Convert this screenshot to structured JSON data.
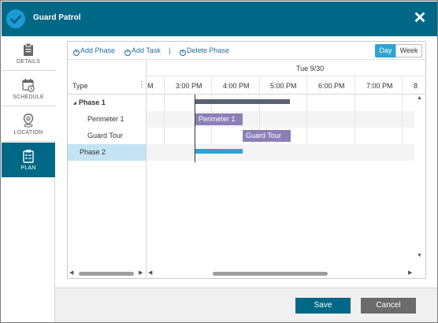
{
  "window": {
    "title": "Guard Patrol"
  },
  "sidebar": {
    "items": [
      {
        "label": "DETAILS",
        "icon": "clipboard-icon",
        "active": false
      },
      {
        "label": "SCHEDULE",
        "icon": "calendar-clock-icon",
        "active": false
      },
      {
        "label": "LOCATION",
        "icon": "map-pin-icon",
        "active": false
      },
      {
        "label": "PLAN",
        "icon": "plan-checklist-icon",
        "active": true
      }
    ]
  },
  "toolbar": {
    "add_phase": "Add Phase",
    "add_task": "Add Task",
    "separator": "|",
    "delete_phase": "Delete Phase",
    "view_day": "Day",
    "view_week": "Week",
    "selected_view": "Day"
  },
  "tree": {
    "header": "Type",
    "menu_glyph": "⋮",
    "rows": [
      {
        "label": "Phase 1",
        "level": 0,
        "expanded": true,
        "selected": false
      },
      {
        "label": "Perimeter 1",
        "level": 1,
        "selected": false
      },
      {
        "label": "Guard Tour",
        "level": 1,
        "selected": false
      },
      {
        "label": "Phase 2",
        "level": 0,
        "selected": true
      }
    ]
  },
  "timeline": {
    "date": "Tue 9/30",
    "hours": [
      "M",
      "3:00 PM",
      "4:00 PM",
      "5:00 PM",
      "6:00 PM",
      "7:00 PM",
      "8"
    ],
    "tasks": [
      {
        "name": "Phase 1",
        "type": "summary",
        "start": "3:00 PM",
        "end": "5:00 PM"
      },
      {
        "name": "Perimeter 1",
        "type": "task",
        "start": "3:00 PM",
        "end": "4:00 PM"
      },
      {
        "name": "Guard Tour",
        "type": "task",
        "start": "4:00 PM",
        "end": "5:00 PM"
      },
      {
        "name": "Phase 2",
        "type": "summary",
        "start": "3:00 PM",
        "end": "4:00 PM"
      }
    ]
  },
  "footer": {
    "save": "Save",
    "cancel": "Cancel"
  },
  "colors": {
    "header": "#006887",
    "active_nav": "#006887",
    "task_bar": "#8c7fb8",
    "summary_bar": "#5a6170",
    "phase2_bar": "#2ea3d1",
    "selected_row": "#c4e3f3",
    "cancel": "#6b6b6b"
  }
}
